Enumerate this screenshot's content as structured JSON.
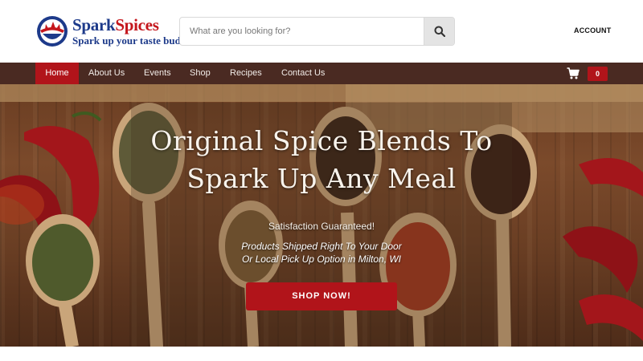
{
  "brand": {
    "name_part1": "Spark",
    "name_part2": "Spices",
    "tagline": "Spark up your taste buds",
    "primary_color": "#1d3a8a",
    "accent_color": "#c4161c"
  },
  "search": {
    "placeholder": "What are you looking for?",
    "value": "",
    "icon": "search-icon"
  },
  "header": {
    "account_label": "ACCOUNT"
  },
  "nav": {
    "items": [
      {
        "label": "Home",
        "active": true
      },
      {
        "label": "About Us",
        "active": false
      },
      {
        "label": "Events",
        "active": false
      },
      {
        "label": "Shop",
        "active": false
      },
      {
        "label": "Recipes",
        "active": false
      },
      {
        "label": "Contact Us",
        "active": false
      }
    ],
    "cart_icon": "cart-icon",
    "cart_count": "0",
    "background_color": "#4a2a22",
    "active_color": "#b1141a"
  },
  "hero": {
    "title_line1": "Original Spice Blends To",
    "title_line2": "Spark Up Any Meal",
    "subtitle": "Satisfaction Guaranteed!",
    "line1": "Products Shipped Right To Your Door",
    "line2": "Or Local Pick Up Option in Milton, WI",
    "cta_label": "SHOP NOW!"
  }
}
